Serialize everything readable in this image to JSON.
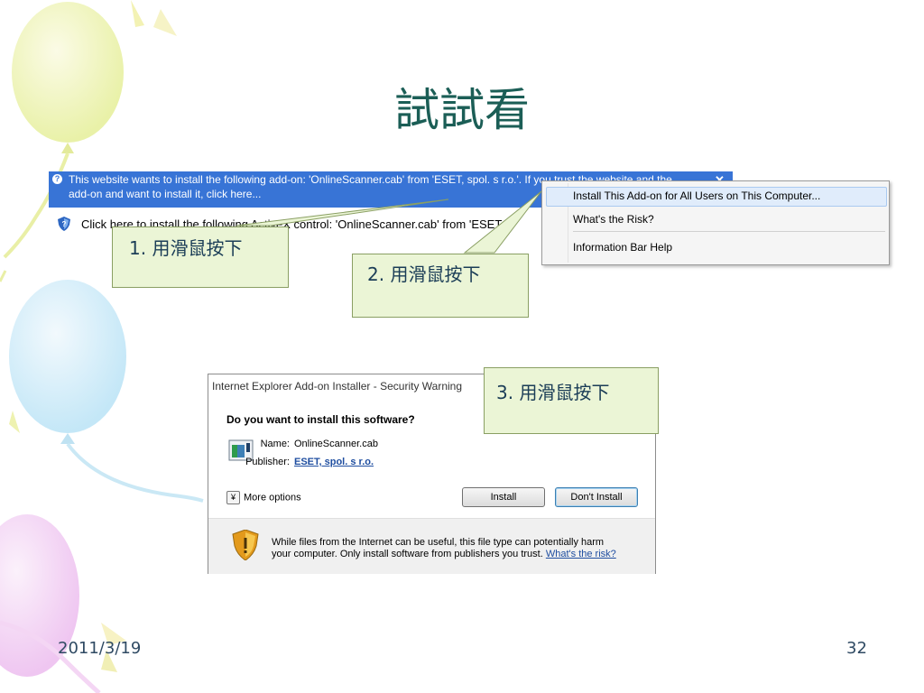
{
  "slide": {
    "title": "試試看",
    "date": "2011/3/19",
    "page_number": "32"
  },
  "infobar": {
    "line1": "This website wants to install the following add-on: 'OnlineScanner.cab' from 'ESET, spol. s r.o.'. If you trust the website and the",
    "line2": "add-on and want to install it, click here...",
    "close_glyph": "✕",
    "icon": "info-icon"
  },
  "activex_line": {
    "text": "Click here to install the following ActiveX control: 'OnlineScanner.cab' from 'ESET",
    "icon": "shield-icon"
  },
  "context_menu": {
    "items": [
      "Install This Add-on for All Users on This Computer...",
      "What's the Risk?",
      "Information Bar Help"
    ]
  },
  "callouts": [
    "1. 用滑鼠按下",
    "2. 用滑鼠按下",
    "3. 用滑鼠按下"
  ],
  "dialog": {
    "title": "Internet Explorer Add-on Installer - Security Warning",
    "question": "Do you want to install this software?",
    "name_label": "Name:",
    "name_value": "OnlineScanner.cab",
    "publisher_label": "Publisher:",
    "publisher_value": "ESET, spol. s r.o.",
    "more_options": "More options",
    "install_button": "Install",
    "dont_install_button": "Don't Install",
    "warning_line1": "While files from the Internet can be useful, this file type can potentially harm",
    "warning_line2": "your computer. Only install software from publishers you trust.",
    "risk_link": "What's the risk?"
  },
  "colors": {
    "title": "#1b5e56",
    "infobar": "#3874d6",
    "callout_fill": "#ebf5d6",
    "callout_text": "#1b3d57"
  }
}
